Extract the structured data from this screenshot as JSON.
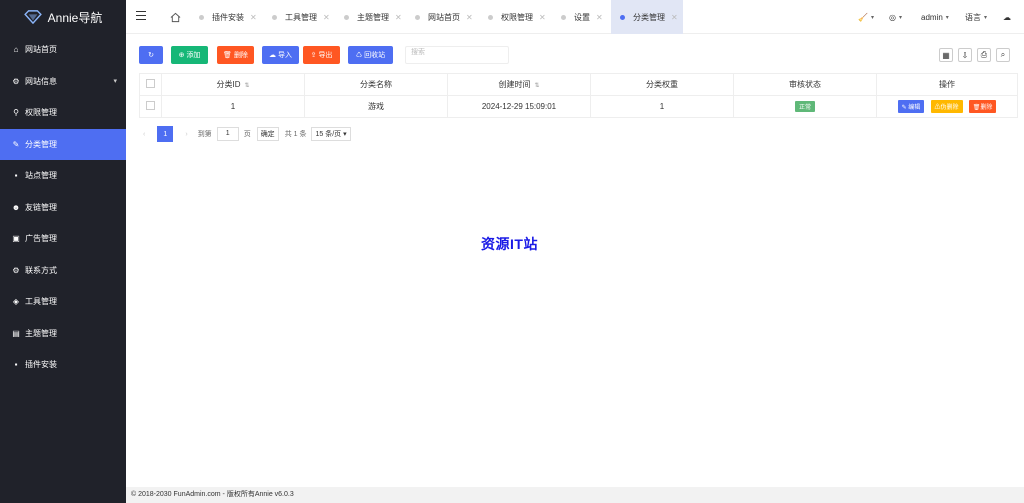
{
  "app": {
    "title": "Annie导航"
  },
  "sidebar": {
    "items": [
      {
        "label": "网站首页",
        "icon": "home-icon"
      },
      {
        "label": "网站信息",
        "icon": "settings-icon",
        "has_children": true
      },
      {
        "label": "权限管理",
        "icon": "permission-icon"
      },
      {
        "label": "分类管理",
        "icon": "category-icon",
        "active": true
      },
      {
        "label": "站点管理",
        "icon": "site-icon"
      },
      {
        "label": "友链管理",
        "icon": "users-icon"
      },
      {
        "label": "广告管理",
        "icon": "image-icon"
      },
      {
        "label": "联系方式",
        "icon": "contact-icon"
      },
      {
        "label": "工具管理",
        "icon": "shield-icon"
      },
      {
        "label": "主题管理",
        "icon": "theme-icon"
      },
      {
        "label": "插件安装",
        "icon": "plugin-icon"
      }
    ]
  },
  "header": {
    "tabs": [
      {
        "label": "插件安装"
      },
      {
        "label": "工具管理"
      },
      {
        "label": "主题管理"
      },
      {
        "label": "网站首页"
      },
      {
        "label": "权限管理"
      },
      {
        "label": "设置"
      },
      {
        "label": "分类管理",
        "active": true
      }
    ],
    "user": "admin",
    "language": "语言"
  },
  "toolbar": {
    "refresh": "",
    "add": "添加",
    "delete": "删除",
    "import": "导入",
    "export": "导出",
    "recycle": "回收站",
    "search_placeholder": "搜索"
  },
  "table": {
    "columns": [
      "分类ID",
      "分类名称",
      "创建时间",
      "分类权重",
      "审核状态",
      "操作"
    ],
    "rows": [
      {
        "id": "1",
        "name": "游戏",
        "created": "2024-12-29 15:09:01",
        "weight": "1",
        "status": "正常"
      }
    ],
    "actions": {
      "edit": "编辑",
      "soft_delete": "伪删除",
      "delete": "删除"
    }
  },
  "pager": {
    "current": "1",
    "goto_label": "到第",
    "goto_value": "1",
    "page_label": "页",
    "confirm": "确定",
    "total": "共 1 条",
    "page_size": "15 条/页"
  },
  "watermark": "资源IT站",
  "footer": "© 2018-2030 FunAdmin.com - 版权所有Annie v6.0.3",
  "colors": {
    "sidebar_bg": "#20222a",
    "accent": "#4e6ef2",
    "green": "#16b777",
    "orange": "#ff5722",
    "yellow": "#ffb800",
    "status_green": "#5fb878"
  }
}
